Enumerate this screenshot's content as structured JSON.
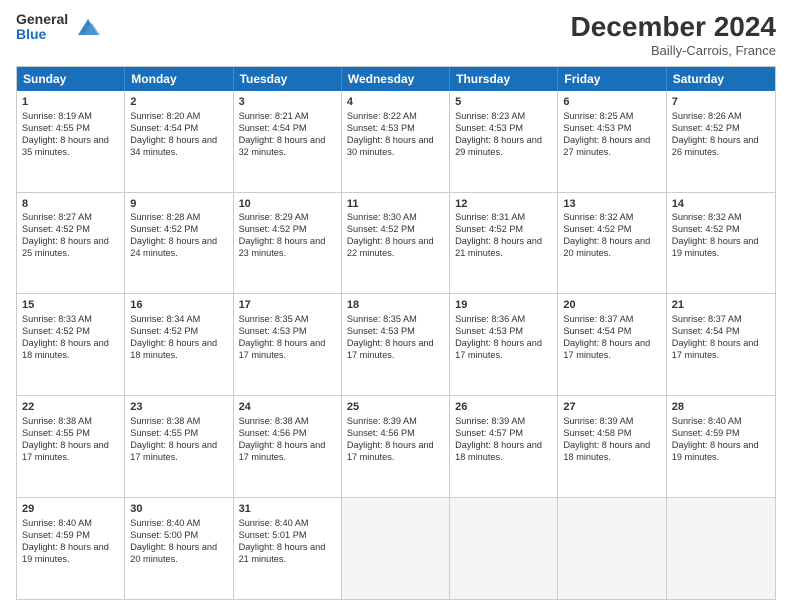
{
  "header": {
    "logo_general": "General",
    "logo_blue": "Blue",
    "month_title": "December 2024",
    "location": "Bailly-Carrois, France"
  },
  "weekdays": [
    "Sunday",
    "Monday",
    "Tuesday",
    "Wednesday",
    "Thursday",
    "Friday",
    "Saturday"
  ],
  "rows": [
    [
      {
        "day": "1",
        "sunrise": "8:19 AM",
        "sunset": "4:55 PM",
        "daylight": "8 hours and 35 minutes."
      },
      {
        "day": "2",
        "sunrise": "8:20 AM",
        "sunset": "4:54 PM",
        "daylight": "8 hours and 34 minutes."
      },
      {
        "day": "3",
        "sunrise": "8:21 AM",
        "sunset": "4:54 PM",
        "daylight": "8 hours and 32 minutes."
      },
      {
        "day": "4",
        "sunrise": "8:22 AM",
        "sunset": "4:53 PM",
        "daylight": "8 hours and 30 minutes."
      },
      {
        "day": "5",
        "sunrise": "8:23 AM",
        "sunset": "4:53 PM",
        "daylight": "8 hours and 29 minutes."
      },
      {
        "day": "6",
        "sunrise": "8:25 AM",
        "sunset": "4:53 PM",
        "daylight": "8 hours and 27 minutes."
      },
      {
        "day": "7",
        "sunrise": "8:26 AM",
        "sunset": "4:52 PM",
        "daylight": "8 hours and 26 minutes."
      }
    ],
    [
      {
        "day": "8",
        "sunrise": "8:27 AM",
        "sunset": "4:52 PM",
        "daylight": "8 hours and 25 minutes."
      },
      {
        "day": "9",
        "sunrise": "8:28 AM",
        "sunset": "4:52 PM",
        "daylight": "8 hours and 24 minutes."
      },
      {
        "day": "10",
        "sunrise": "8:29 AM",
        "sunset": "4:52 PM",
        "daylight": "8 hours and 23 minutes."
      },
      {
        "day": "11",
        "sunrise": "8:30 AM",
        "sunset": "4:52 PM",
        "daylight": "8 hours and 22 minutes."
      },
      {
        "day": "12",
        "sunrise": "8:31 AM",
        "sunset": "4:52 PM",
        "daylight": "8 hours and 21 minutes."
      },
      {
        "day": "13",
        "sunrise": "8:32 AM",
        "sunset": "4:52 PM",
        "daylight": "8 hours and 20 minutes."
      },
      {
        "day": "14",
        "sunrise": "8:32 AM",
        "sunset": "4:52 PM",
        "daylight": "8 hours and 19 minutes."
      }
    ],
    [
      {
        "day": "15",
        "sunrise": "8:33 AM",
        "sunset": "4:52 PM",
        "daylight": "8 hours and 18 minutes."
      },
      {
        "day": "16",
        "sunrise": "8:34 AM",
        "sunset": "4:52 PM",
        "daylight": "8 hours and 18 minutes."
      },
      {
        "day": "17",
        "sunrise": "8:35 AM",
        "sunset": "4:53 PM",
        "daylight": "8 hours and 17 minutes."
      },
      {
        "day": "18",
        "sunrise": "8:35 AM",
        "sunset": "4:53 PM",
        "daylight": "8 hours and 17 minutes."
      },
      {
        "day": "19",
        "sunrise": "8:36 AM",
        "sunset": "4:53 PM",
        "daylight": "8 hours and 17 minutes."
      },
      {
        "day": "20",
        "sunrise": "8:37 AM",
        "sunset": "4:54 PM",
        "daylight": "8 hours and 17 minutes."
      },
      {
        "day": "21",
        "sunrise": "8:37 AM",
        "sunset": "4:54 PM",
        "daylight": "8 hours and 17 minutes."
      }
    ],
    [
      {
        "day": "22",
        "sunrise": "8:38 AM",
        "sunset": "4:55 PM",
        "daylight": "8 hours and 17 minutes."
      },
      {
        "day": "23",
        "sunrise": "8:38 AM",
        "sunset": "4:55 PM",
        "daylight": "8 hours and 17 minutes."
      },
      {
        "day": "24",
        "sunrise": "8:38 AM",
        "sunset": "4:56 PM",
        "daylight": "8 hours and 17 minutes."
      },
      {
        "day": "25",
        "sunrise": "8:39 AM",
        "sunset": "4:56 PM",
        "daylight": "8 hours and 17 minutes."
      },
      {
        "day": "26",
        "sunrise": "8:39 AM",
        "sunset": "4:57 PM",
        "daylight": "8 hours and 18 minutes."
      },
      {
        "day": "27",
        "sunrise": "8:39 AM",
        "sunset": "4:58 PM",
        "daylight": "8 hours and 18 minutes."
      },
      {
        "day": "28",
        "sunrise": "8:40 AM",
        "sunset": "4:59 PM",
        "daylight": "8 hours and 19 minutes."
      }
    ],
    [
      {
        "day": "29",
        "sunrise": "8:40 AM",
        "sunset": "4:59 PM",
        "daylight": "8 hours and 19 minutes."
      },
      {
        "day": "30",
        "sunrise": "8:40 AM",
        "sunset": "5:00 PM",
        "daylight": "8 hours and 20 minutes."
      },
      {
        "day": "31",
        "sunrise": "8:40 AM",
        "sunset": "5:01 PM",
        "daylight": "8 hours and 21 minutes."
      },
      null,
      null,
      null,
      null
    ]
  ]
}
